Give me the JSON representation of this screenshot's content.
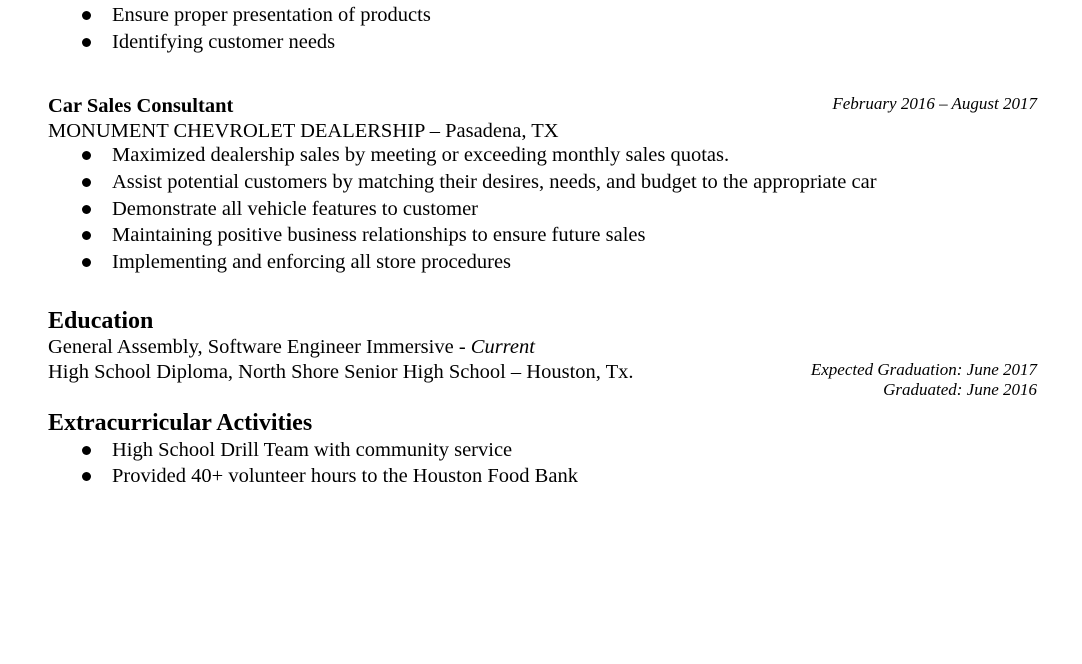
{
  "top_bullets": [
    "Ensure proper presentation of products",
    "Identifying customer needs"
  ],
  "job": {
    "title": "Car Sales Consultant",
    "dates": "February 2016 – August 2017",
    "employer": "MONUMENT CHEVROLET DEALERSHIP – Pasadena, TX",
    "bullets": [
      "Maximized dealership sales by meeting or exceeding monthly sales quotas.",
      "Assist potential customers by matching their desires, needs, and budget to the appropriate car",
      "Demonstrate all vehicle features to customer",
      "Maintaining positive business relationships to ensure future sales",
      "Implementing and enforcing all store procedures"
    ]
  },
  "education": {
    "heading": "Education",
    "entry1_main": "General Assembly, Software Engineer Immersive - ",
    "entry1_status": "Current",
    "entry2_main": "High School Diploma, North Shore Senior High School – Houston, Tx.",
    "expected_graduation": "Expected Graduation: June 2017",
    "graduated": "Graduated: June 2016"
  },
  "extracurricular": {
    "heading": "Extracurricular Activities",
    "bullets": [
      "High School Drill Team with community service",
      "Provided 40+ volunteer hours to the Houston Food Bank"
    ]
  }
}
